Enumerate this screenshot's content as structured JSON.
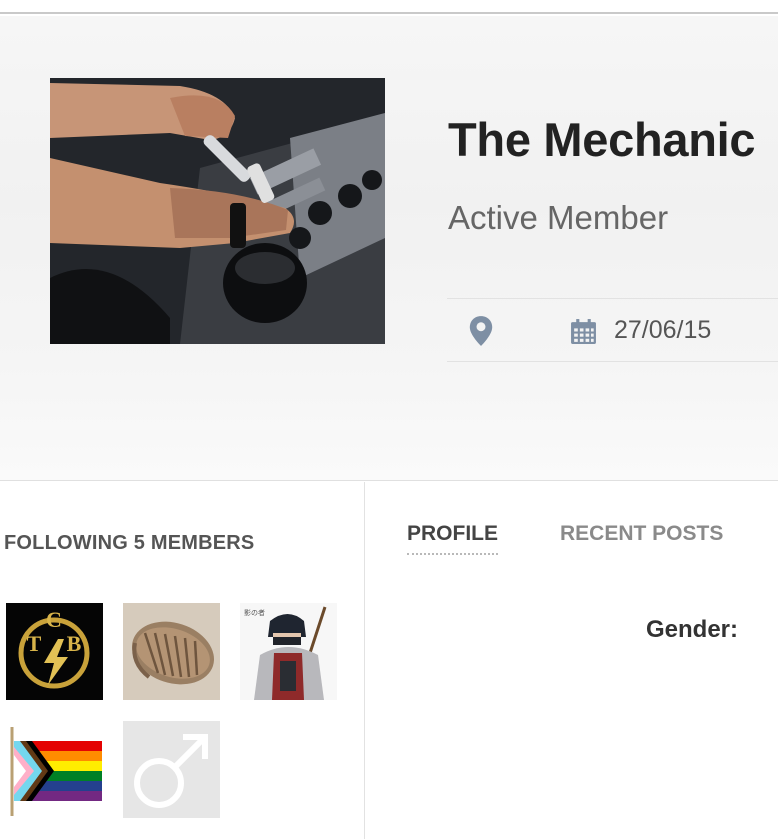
{
  "profile": {
    "name": "The Mechanic",
    "rank": "Active Member",
    "join_date": "27/06/15",
    "avatar_icon": "avatar-engine-photo"
  },
  "sidebar": {
    "following_title": "FOLLOWING 5 MEMBERS",
    "members": [
      {
        "icon": "tcb-lightning-logo"
      },
      {
        "icon": "trilobite-fossil"
      },
      {
        "icon": "samurai-figure"
      },
      {
        "icon": "progress-pride-flag"
      },
      {
        "icon": "male-symbol"
      }
    ]
  },
  "tabs": {
    "profile_label": "PROFILE",
    "recent_posts_label": "RECENT POSTS",
    "active": "PROFILE"
  },
  "details": {
    "gender_label": "Gender:"
  },
  "colors": {
    "icon_blue": "#7e8fa4",
    "header_bg": "#f2f2f2",
    "text_dark": "#222222"
  }
}
